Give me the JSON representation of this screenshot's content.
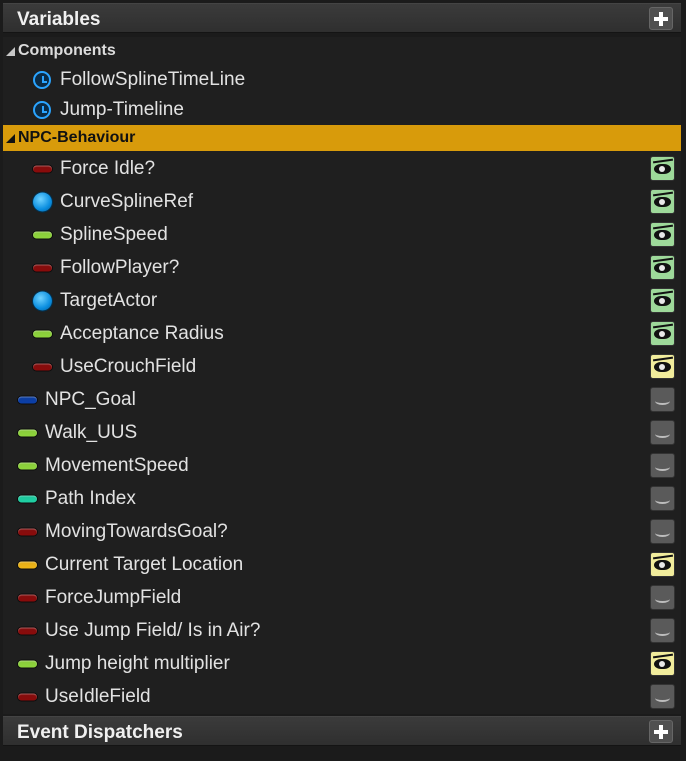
{
  "variables_header": {
    "title": "Variables"
  },
  "event_dispatchers_header": {
    "title": "Event Dispatchers"
  },
  "categories": {
    "components": "Components",
    "npc_behaviour": "NPC-Behaviour"
  },
  "components": [
    {
      "label": "FollowSplineTimeLine",
      "icon": "timeline-icon"
    },
    {
      "label": "Jump-Timeline",
      "icon": "timeline-icon"
    }
  ],
  "npc_behaviour": [
    {
      "label": "Force Idle?",
      "icon": "boolean-pin-icon",
      "color": "#8a0b0b",
      "visibility": "visible-green"
    },
    {
      "label": "CurveSplineRef",
      "icon": "object-ref-icon",
      "color": "#0a8ee0",
      "visibility": "visible-green"
    },
    {
      "label": "SplineSpeed",
      "icon": "float-pin-icon",
      "color": "#8fd63c",
      "visibility": "visible-green"
    },
    {
      "label": "FollowPlayer?",
      "icon": "boolean-pin-icon",
      "color": "#8a0b0b",
      "visibility": "visible-green"
    },
    {
      "label": "TargetActor",
      "icon": "object-ref-icon",
      "color": "#0a8ee0",
      "visibility": "visible-green"
    },
    {
      "label": "Acceptance Radius",
      "icon": "float-pin-icon",
      "color": "#8fd63c",
      "visibility": "visible-green"
    },
    {
      "label": "UseCrouchField",
      "icon": "boolean-pin-icon",
      "color": "#8a0b0b",
      "visibility": "visible-yellow"
    }
  ],
  "uncategorized": [
    {
      "label": "NPC_Goal",
      "icon": "byte-pin-icon",
      "color": "#0b3fa8",
      "visibility": "hidden"
    },
    {
      "label": "Walk_UUS",
      "icon": "float-pin-icon",
      "color": "#8fd63c",
      "visibility": "hidden"
    },
    {
      "label": "MovementSpeed",
      "icon": "float-pin-icon",
      "color": "#8fd63c",
      "visibility": "hidden"
    },
    {
      "label": "Path Index",
      "icon": "integer-pin-icon",
      "color": "#1fd1a4",
      "visibility": "hidden"
    },
    {
      "label": "MovingTowardsGoal?",
      "icon": "boolean-pin-icon",
      "color": "#8a0b0b",
      "visibility": "hidden"
    },
    {
      "label": "Current Target Location",
      "icon": "vector-pin-icon",
      "color": "#f0b617",
      "visibility": "visible-yellow"
    },
    {
      "label": "ForceJumpField",
      "icon": "boolean-pin-icon",
      "color": "#8a0b0b",
      "visibility": "hidden"
    },
    {
      "label": "Use Jump Field/ Is in Air?",
      "icon": "boolean-pin-icon",
      "color": "#8a0b0b",
      "visibility": "hidden"
    },
    {
      "label": "Jump height multiplier",
      "icon": "float-pin-icon",
      "color": "#8fd63c",
      "visibility": "visible-yellow"
    },
    {
      "label": "UseIdleField",
      "icon": "boolean-pin-icon",
      "color": "#8a0b0b",
      "visibility": "hidden"
    }
  ]
}
